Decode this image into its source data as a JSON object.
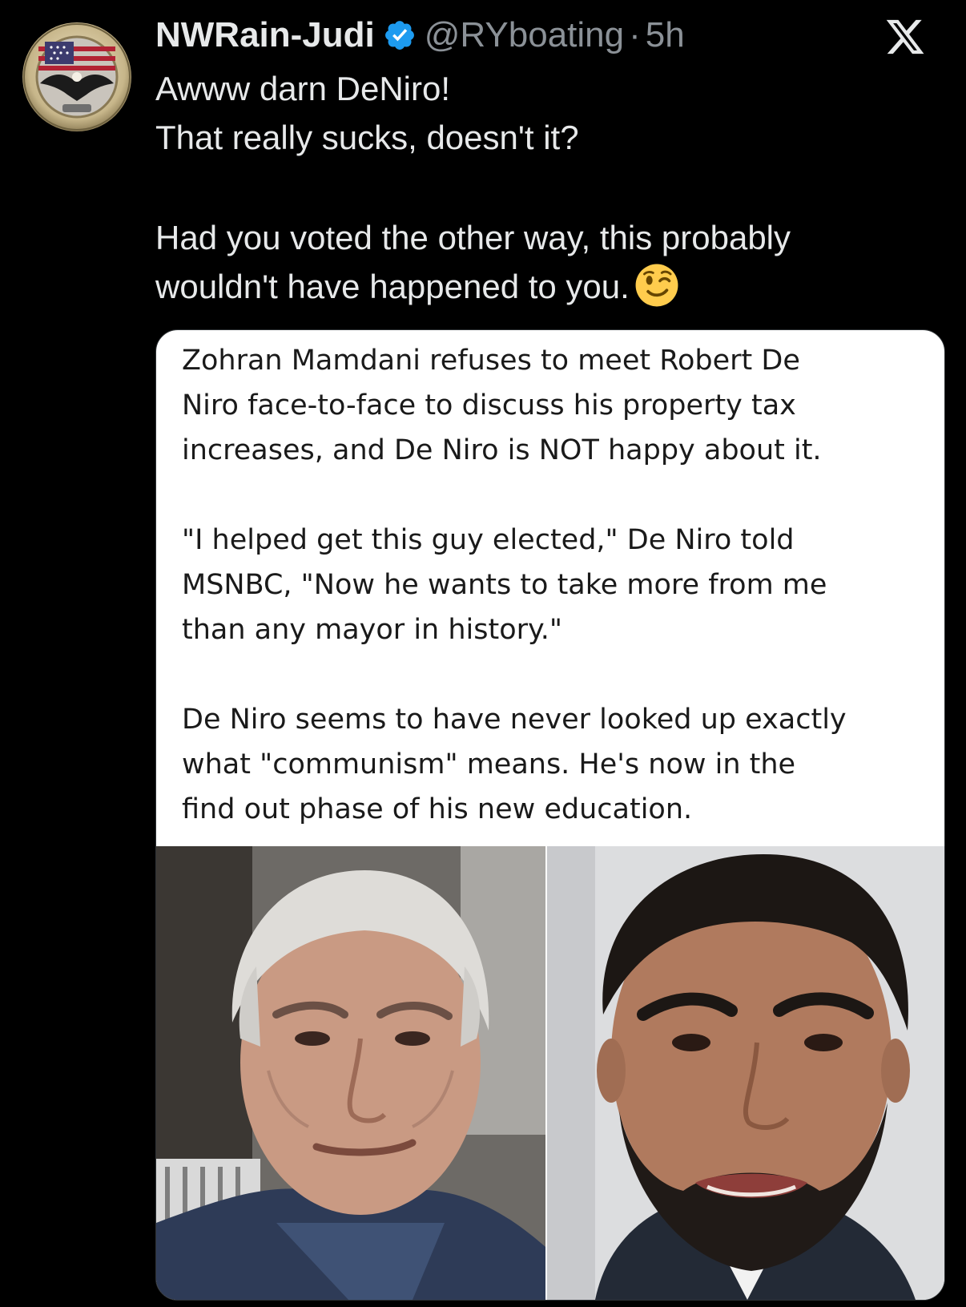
{
  "author": {
    "display_name": "NWRain-Judi",
    "handle": "@RYboating",
    "separator": "·",
    "time": "5h",
    "verified": true,
    "avatar_icon": "eagle-flag-coin-avatar"
  },
  "header": {
    "close_icon": "x-logo-icon"
  },
  "tweet": {
    "lines": [
      "Awww darn DeNiro!",
      "That really sucks, doesn't it?",
      "",
      "Had you voted the other way, this probably",
      "wouldn't have happened to you."
    ],
    "emoji": "winking-face-emoji"
  },
  "media": {
    "text_lines": [
      "Zohran Mamdani refuses to meet Robert De",
      "Niro face-to-face to discuss his property tax",
      "increases, and De Niro is NOT happy about it.",
      "",
      "\"I helped get this guy elected,\" De Niro told",
      "MSNBC, \"Now he wants to take more from me",
      "than any mayor in history.\"",
      "",
      "De Niro seems to have never looked up exactly",
      "what \"communism\" means. He's now in the",
      "find out phase of his new education."
    ],
    "left_photo": "older-man-gray-hair-photo",
    "right_photo": "bearded-man-photo"
  },
  "colors": {
    "background": "#000000",
    "text": "#e7e9ea",
    "secondary_text": "#8b9197",
    "verified_blue": "#1d9bf0",
    "card_background": "#ffffff"
  }
}
